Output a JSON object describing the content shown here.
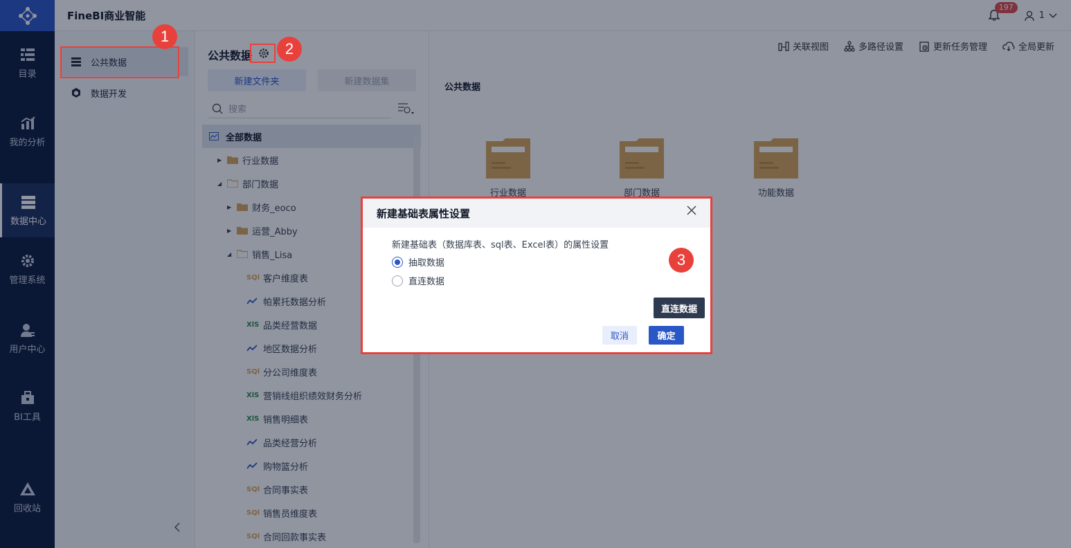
{
  "app": {
    "title": "FineBI商业智能"
  },
  "header": {
    "notification_count": "197",
    "user": "1"
  },
  "rail": {
    "items": [
      {
        "label": "目录",
        "icon": "catalog-icon"
      },
      {
        "label": "我的分析",
        "icon": "analysis-icon"
      },
      {
        "label": "数据中心",
        "icon": "data-center-icon"
      },
      {
        "label": "管理系统",
        "icon": "gear-icon"
      },
      {
        "label": "用户中心",
        "icon": "user-icon"
      },
      {
        "label": "BI工具",
        "icon": "toolbox-icon"
      },
      {
        "label": "回收站",
        "icon": "recycle-icon"
      }
    ]
  },
  "subnav": {
    "items": [
      {
        "label": "公共数据"
      },
      {
        "label": "数据开发"
      }
    ]
  },
  "tree": {
    "title": "公共数据",
    "new_folder": "新建文件夹",
    "new_dataset": "新建数据集",
    "search_placeholder": "搜索",
    "rows": [
      {
        "label": "全部数据",
        "type": "root"
      },
      {
        "label": "行业数据",
        "type": "folder"
      },
      {
        "label": "部门数据",
        "type": "folder"
      },
      {
        "label": "财务_eoco",
        "type": "folder"
      },
      {
        "label": "运营_Abby",
        "type": "folder"
      },
      {
        "label": "销售_Lisa",
        "type": "folder"
      },
      {
        "label": "客户维度表",
        "type": "sql"
      },
      {
        "label": "帕累托数据分析",
        "type": "analysis"
      },
      {
        "label": "品类经营数据",
        "type": "xls"
      },
      {
        "label": "地区数据分析",
        "type": "analysis"
      },
      {
        "label": "分公司维度表",
        "type": "sql"
      },
      {
        "label": "营销线组织绩效财务分析",
        "type": "xls"
      },
      {
        "label": "销售明细表",
        "type": "xls"
      },
      {
        "label": "品类经营分析",
        "type": "analysis"
      },
      {
        "label": "购物篮分析",
        "type": "analysis"
      },
      {
        "label": "合同事实表",
        "type": "sql"
      },
      {
        "label": "销售员维度表",
        "type": "sql"
      },
      {
        "label": "合同回款事实表",
        "type": "sql"
      }
    ]
  },
  "toolbar": {
    "items": [
      "关联视图",
      "多路径设置",
      "更新任务管理",
      "全局更新"
    ]
  },
  "main": {
    "breadcrumb": "公共数据",
    "folders": [
      "行业数据",
      "部门数据",
      "功能数据"
    ]
  },
  "dialog": {
    "title": "新建基础表属性设置",
    "description": "新建基础表（数据库表、sql表、Excel表）的属性设置",
    "options": [
      "抽取数据",
      "直连数据"
    ],
    "selected": "抽取数据",
    "tooltip": "直连数据",
    "cancel": "取消",
    "confirm": "确定"
  },
  "markers": [
    "1",
    "2",
    "3"
  ],
  "colors": {
    "rail_bg": "#0a1a3d",
    "accent": "#2a57c6",
    "marker": "#e8413c"
  }
}
